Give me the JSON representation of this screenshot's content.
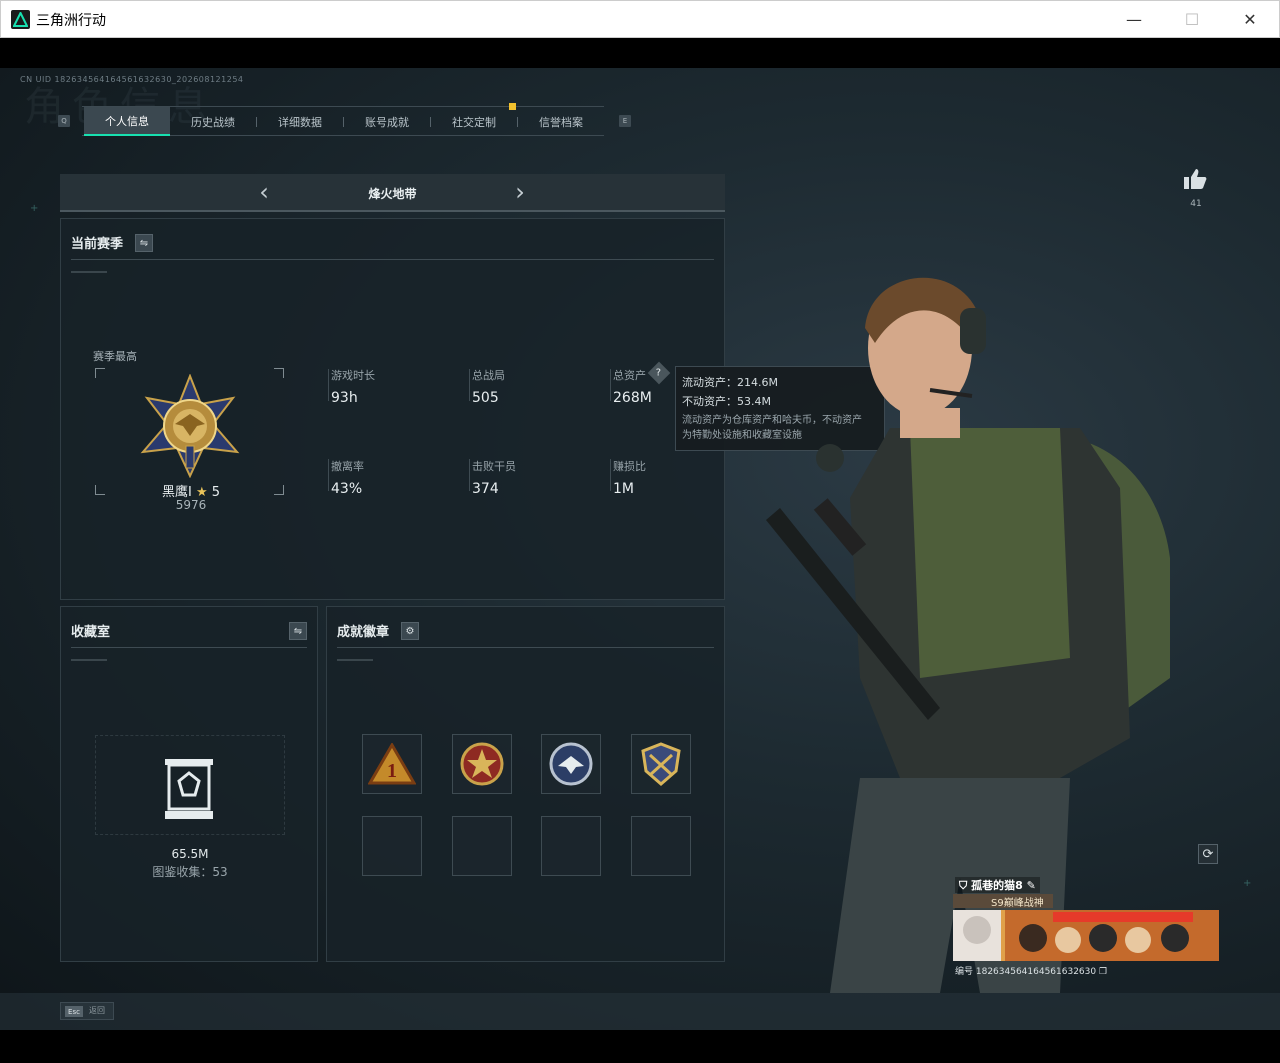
{
  "window": {
    "title": "三角洲行动",
    "min_label": "—",
    "max_label": "☐",
    "close_label": "✕"
  },
  "header": {
    "uid": "CN UID 182634564164561632630_202608121254",
    "bg_title": "角色信息"
  },
  "tabs": [
    {
      "label": "个人信息",
      "active": true
    },
    {
      "label": "历史战绩"
    },
    {
      "label": "详细数据"
    },
    {
      "label": "账号成就"
    },
    {
      "label": "社交定制"
    },
    {
      "label": "信誉档案"
    }
  ],
  "tab_keys": {
    "left": "Q",
    "right": "E"
  },
  "mode": {
    "title": "烽火地带",
    "prev": "‹",
    "next": "›"
  },
  "season": {
    "title": "当前赛季",
    "best_label": "赛季最高",
    "rank_name": "黑鹰I",
    "rank_stars": "5",
    "rank_score": "5976",
    "stats": [
      {
        "label": "游戏时长",
        "value": "93h"
      },
      {
        "label": "总战局",
        "value": "505"
      },
      {
        "label": "总资产",
        "value": "268M"
      },
      {
        "label": "撤离率",
        "value": "43%"
      },
      {
        "label": "击败干员",
        "value": "374"
      },
      {
        "label": "赚损比",
        "value": "1M"
      }
    ],
    "help_icon": "?"
  },
  "tooltip": {
    "liquid": "流动资产：214.6M",
    "fixed": "不动资产：53.4M",
    "desc1": "流动资产为仓库资产和哈夫币，不动资产",
    "desc2": "为特勤处设施和收藏室设施"
  },
  "collection": {
    "title": "收藏室",
    "value": "65.5M",
    "count": "图鉴收集：53"
  },
  "achievements": {
    "title": "成就徽章",
    "badge1_text": "1"
  },
  "likes": {
    "count": "41"
  },
  "nameplate": {
    "name": "孤巷的猫8",
    "title": "S9巅峰战神",
    "uid": "编号 182634564164561632630"
  },
  "footer": {
    "esc_key": "Esc",
    "esc_label": "返回"
  },
  "colors": {
    "accent": "#18e0b0",
    "badge_gold": "#c9a24a",
    "tab_badge": "#f2c12e"
  }
}
